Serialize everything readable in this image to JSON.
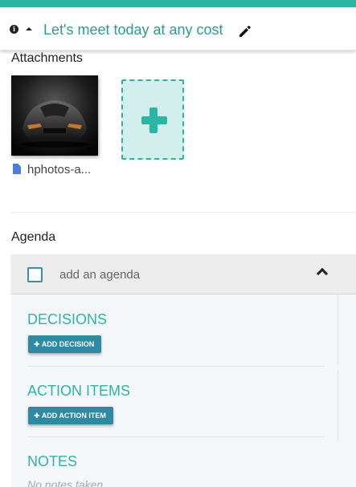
{
  "header": {
    "title": "Let's meet today at any cost",
    "info_icon": "info-circle-icon",
    "toggle_icon": "caret-up-icon",
    "edit_icon": "pencil-icon"
  },
  "attachments": {
    "label": "Attachments",
    "items": [
      {
        "file_name": "hphotos-a...",
        "icon": "file-icon"
      }
    ],
    "add_icon": "plus-icon"
  },
  "agenda": {
    "label": "Agenda",
    "item": {
      "placeholder": "add an agenda",
      "checked": false,
      "expand_icon": "chevron-up-icon"
    },
    "decisions": {
      "heading": "DECISIONS",
      "button": "✚ ADD DECISION"
    },
    "action_items": {
      "heading": "ACTION ITEMS",
      "button": "✚ ADD ACTION ITEM"
    },
    "notes": {
      "heading": "NOTES",
      "empty_text": "No notes taken"
    }
  },
  "colors": {
    "brand": "#2bb6a3",
    "title_text": "#2a9d93",
    "button_bg": "#2e8aa3",
    "checkbox_border": "#3a8db3"
  }
}
